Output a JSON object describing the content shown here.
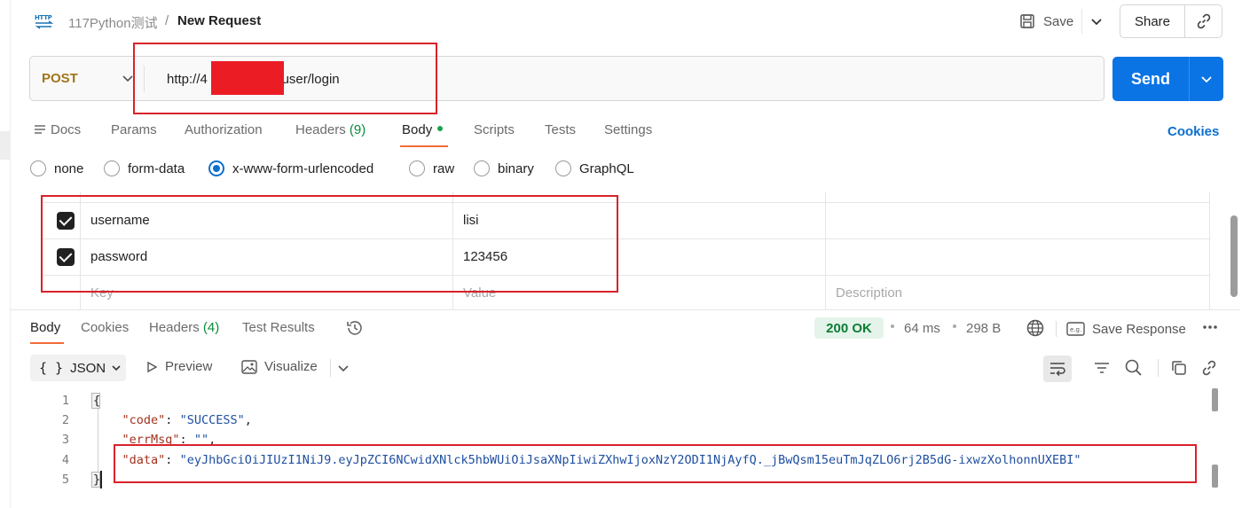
{
  "header": {
    "http_badge": "HTTP",
    "collection": "117Python测试",
    "separator": "/",
    "request_name": "New Request",
    "save_label": "Save",
    "share_label": "Share"
  },
  "request": {
    "method": "POST",
    "url_prefix": "http://4",
    "url_suffix": ":8090/user/login",
    "send_label": "Send"
  },
  "request_tabs": [
    {
      "label": "Docs"
    },
    {
      "label": "Params"
    },
    {
      "label": "Authorization"
    },
    {
      "label": "Headers",
      "count": "(9)"
    },
    {
      "label": "Body"
    },
    {
      "label": "Scripts"
    },
    {
      "label": "Tests"
    },
    {
      "label": "Settings"
    }
  ],
  "cookies_label": "Cookies",
  "body_types": [
    "none",
    "form-data",
    "x-www-form-urlencoded",
    "raw",
    "binary",
    "GraphQL"
  ],
  "body_type_selected": "x-www-form-urlencoded",
  "form_rows": [
    {
      "checked": true,
      "key": "username",
      "value": "lisi"
    },
    {
      "checked": true,
      "key": "password",
      "value": "123456"
    }
  ],
  "form_placeholders": {
    "key": "Key",
    "value": "Value",
    "description": "Description"
  },
  "response_tabs": [
    {
      "label": "Body"
    },
    {
      "label": "Cookies"
    },
    {
      "label": "Headers",
      "count": "(4)"
    },
    {
      "label": "Test Results"
    }
  ],
  "response_meta": {
    "status": "200 OK",
    "time": "64 ms",
    "size": "298 B",
    "save_response": "Save Response"
  },
  "response_toolbar": {
    "format": "JSON",
    "preview": "Preview",
    "visualize": "Visualize"
  },
  "code": {
    "line_numbers": [
      "1",
      "2",
      "3",
      "4",
      "5"
    ],
    "open_brace": "{",
    "close_brace": "}",
    "code_key": "\"code\"",
    "code_val": "\"SUCCESS\"",
    "errmsg_key": "\"errMsg\"",
    "errmsg_val": "\"\"",
    "data_key": "\"data\"",
    "data_val": "\"eyJhbGciOiJIUzI1NiJ9.eyJpZCI6NCwidXNlck5hbWUiOiJsaXNpIiwiZXhwIjoxNzY2ODI1NjAyfQ._jBwQsm15euTmJqZLO6rj2B5dG-ixwzXolhonnUXEBI\""
  },
  "colors": {
    "accent": "#0b74e5",
    "method": "#a0741a",
    "status_ok": "#0a7d35",
    "annotation_red": "#d9222a",
    "tab_underline": "#f26b3a"
  }
}
